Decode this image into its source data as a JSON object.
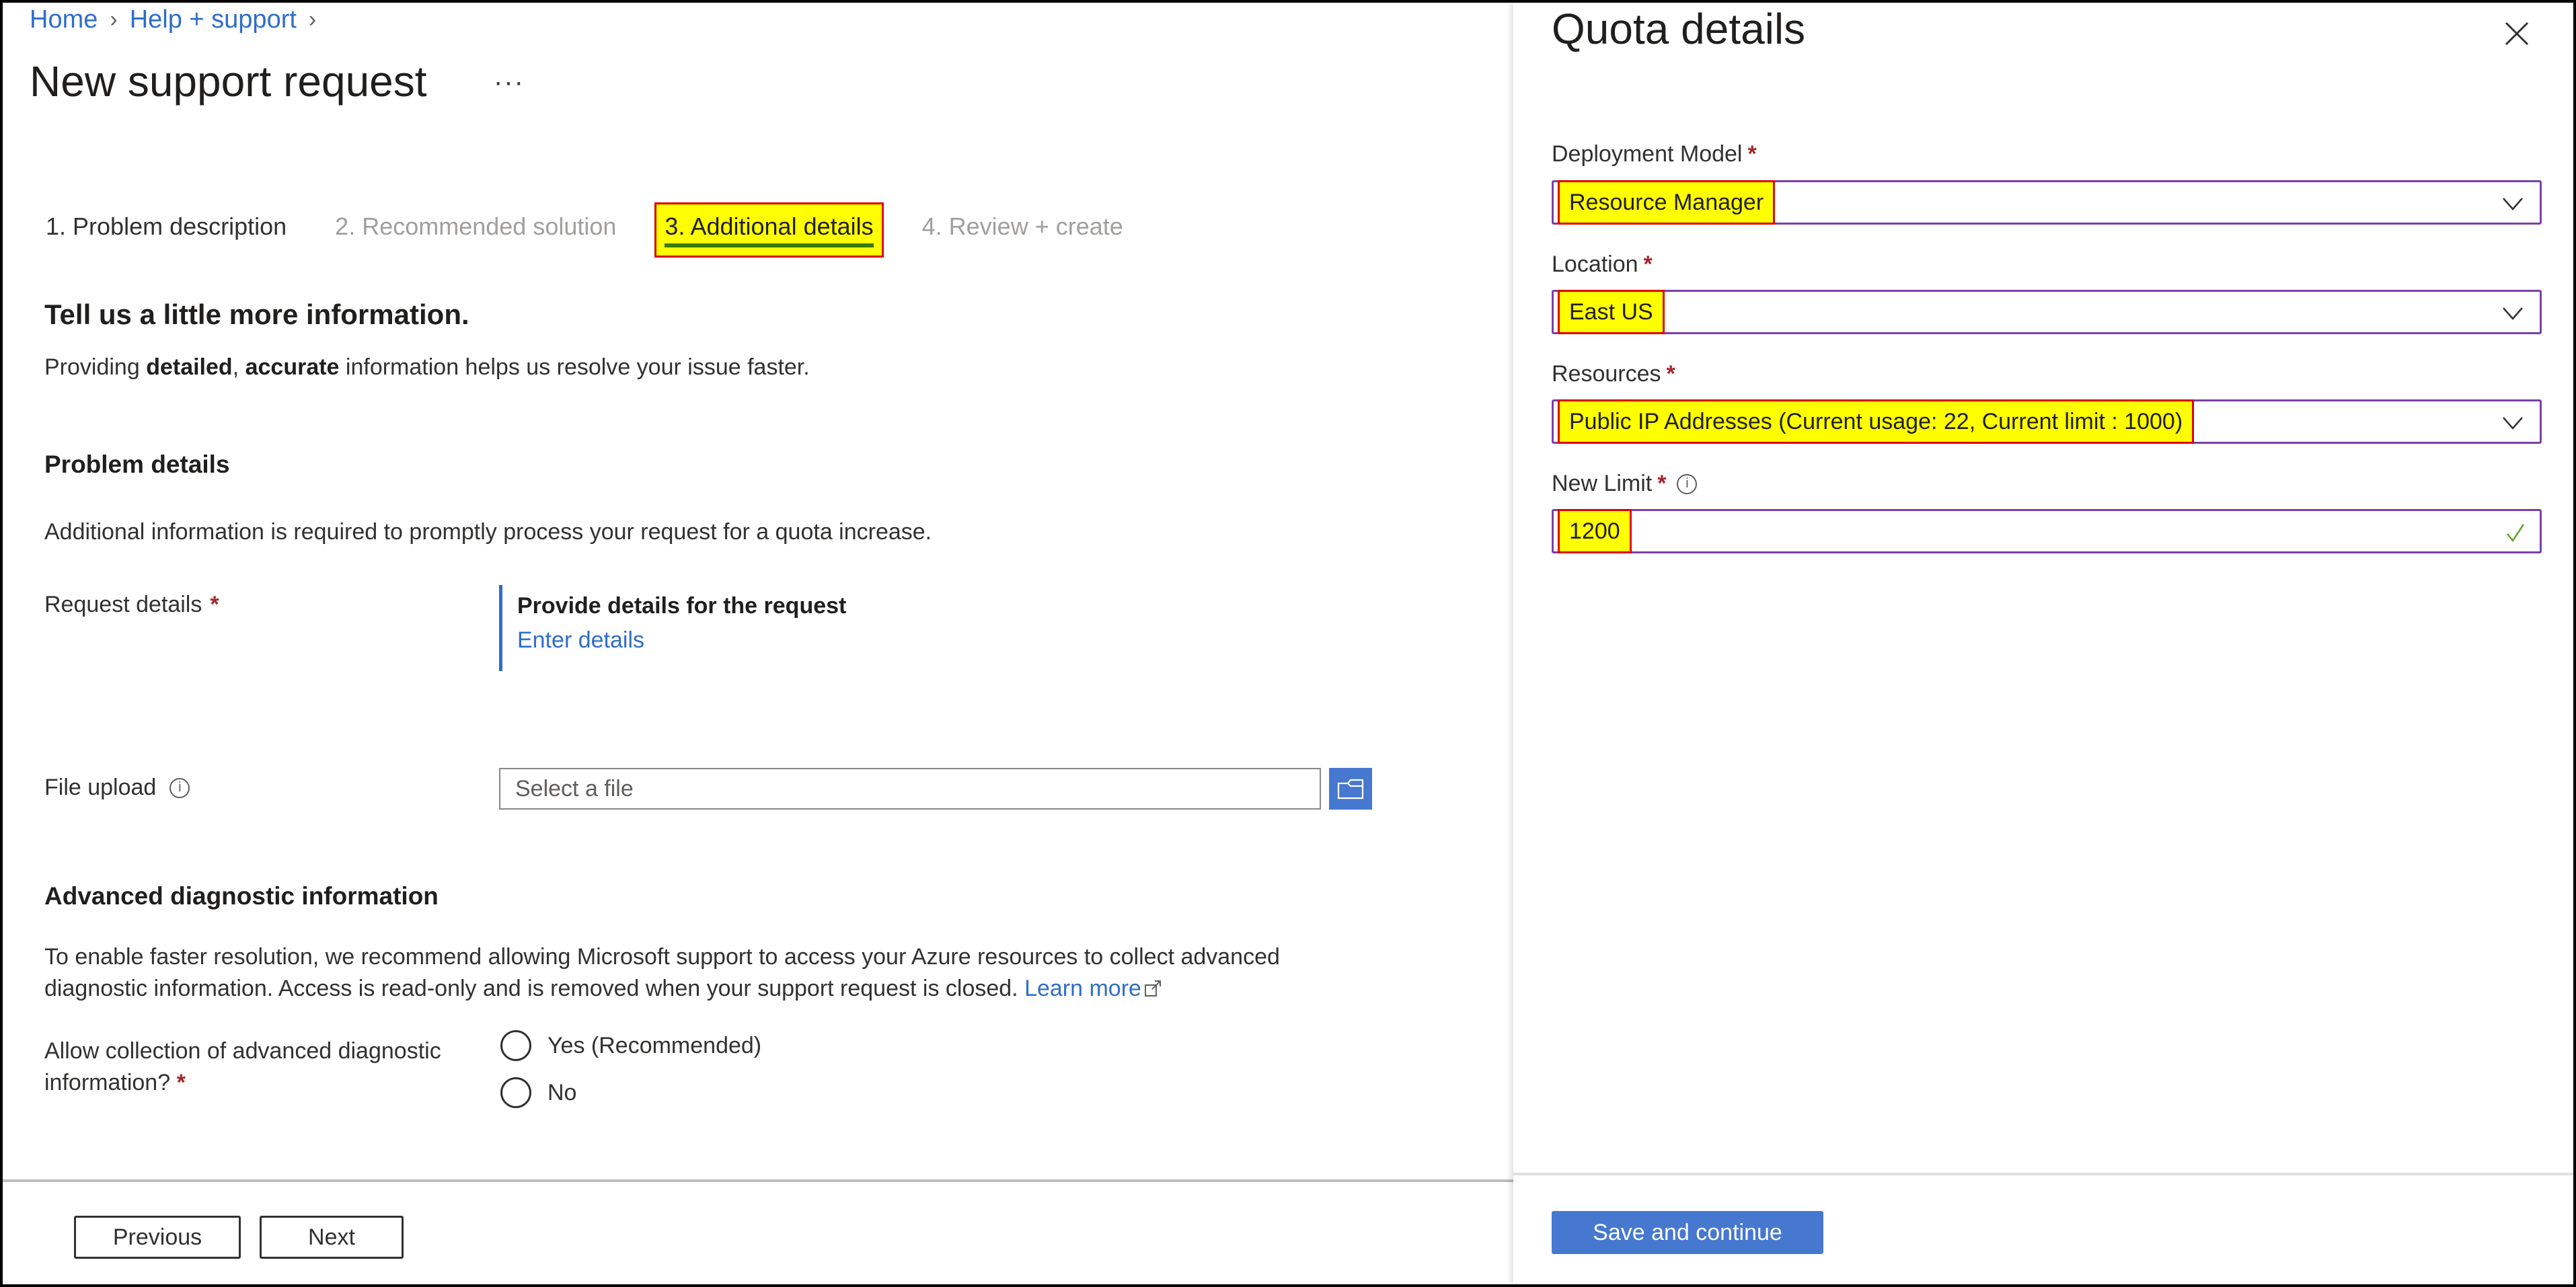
{
  "breadcrumb": {
    "items": [
      "Home",
      "Help + support"
    ]
  },
  "page": {
    "title": "New support request",
    "more_label": "···"
  },
  "tabs": [
    {
      "label": "1. Problem description",
      "state": "done"
    },
    {
      "label": "2. Recommended solution",
      "state": "pending"
    },
    {
      "label": "3. Additional details",
      "state": "active"
    },
    {
      "label": "4. Review + create",
      "state": "pending"
    }
  ],
  "main": {
    "heading": "Tell us a little more information.",
    "intro_prefix": "Providing ",
    "intro_bold1": "detailed",
    "intro_comma": ", ",
    "intro_bold2": "accurate",
    "intro_suffix": " information helps us resolve your issue faster.",
    "problem_heading": "Problem details",
    "problem_text": "Additional information is required to promptly process your request for a quota increase.",
    "request_details_label": "Request details",
    "request_block_title": "Provide details for the request",
    "request_block_link": "Enter details",
    "file_upload_label": "File upload",
    "file_upload_placeholder": "Select a file",
    "adv_heading": "Advanced diagnostic information",
    "adv_text": "To enable faster resolution, we recommend allowing Microsoft support to access your Azure resources to collect advanced diagnostic information. Access is read-only and is removed when your support request is closed. ",
    "adv_link": "Learn more",
    "allow_label": "Allow collection of advanced diagnostic information?",
    "radio_options": [
      "Yes (Recommended)",
      "No"
    ],
    "required_mark": "*"
  },
  "footer": {
    "previous_label": "Previous",
    "next_label": "Next"
  },
  "panel": {
    "title": "Quota details",
    "fields": [
      {
        "label": "Deployment Model",
        "value": "Resource Manager",
        "type": "select"
      },
      {
        "label": "Location",
        "value": "East US",
        "type": "select"
      },
      {
        "label": "Resources",
        "value": "Public IP Addresses (Current usage: 22, Current limit : 1000)",
        "type": "select"
      },
      {
        "label": "New Limit",
        "value": "1200",
        "type": "input",
        "valid": true
      }
    ],
    "save_label": "Save and continue"
  },
  "colors": {
    "link": "#2f6dc9",
    "primary": "#4678d0",
    "highlight": "#ffff00",
    "highlight_border": "#e00000",
    "focus_border": "#7a3fa8",
    "required": "#a4262c",
    "valid": "#5ea52c"
  }
}
